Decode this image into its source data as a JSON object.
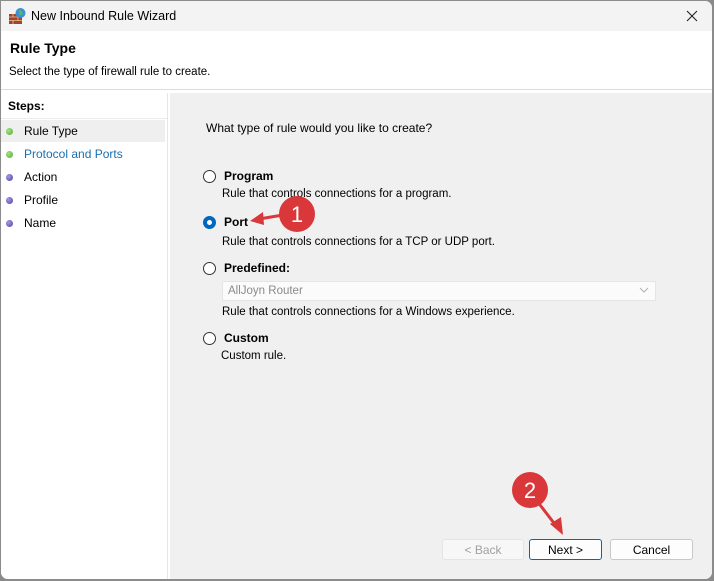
{
  "window": {
    "title": "New Inbound Rule Wizard",
    "app_icon": "firewall-icon",
    "close_icon": "close-icon"
  },
  "header": {
    "title": "Rule Type",
    "subtitle": "Select the type of firewall rule to create."
  },
  "sidebar": {
    "label": "Steps:",
    "steps": [
      {
        "label": "Rule Type",
        "status": "completed",
        "active": true
      },
      {
        "label": "Protocol and Ports",
        "status": "completed",
        "active": false
      },
      {
        "label": "Action",
        "status": "pending",
        "active": false
      },
      {
        "label": "Profile",
        "status": "pending",
        "active": false
      },
      {
        "label": "Name",
        "status": "pending",
        "active": false
      }
    ]
  },
  "main": {
    "question": "What type of rule would you like to create?",
    "options": [
      {
        "label": "Program",
        "description": "Rule that controls connections for a program.",
        "checked": false
      },
      {
        "label": "Port",
        "description": "Rule that controls connections for a TCP or UDP port.",
        "checked": true
      },
      {
        "label": "Predefined:",
        "description": "Rule that controls connections for a Windows experience.",
        "checked": false
      },
      {
        "label": "Custom",
        "description": "Custom rule.",
        "checked": false
      }
    ],
    "predefined_select": {
      "value": "AllJoyn Router",
      "disabled": true
    }
  },
  "buttons": {
    "back": "< Back",
    "next": "Next >",
    "cancel": "Cancel"
  },
  "annotations": [
    {
      "number": "1",
      "target": "Port option"
    },
    {
      "number": "2",
      "target": "Next button"
    }
  ],
  "colors": {
    "accent": "#0067c0",
    "annotation_red": "#d9373a",
    "link_blue": "#1a6fb0",
    "step_done": "#4caf2e",
    "step_pending": "#4a3fa8"
  }
}
